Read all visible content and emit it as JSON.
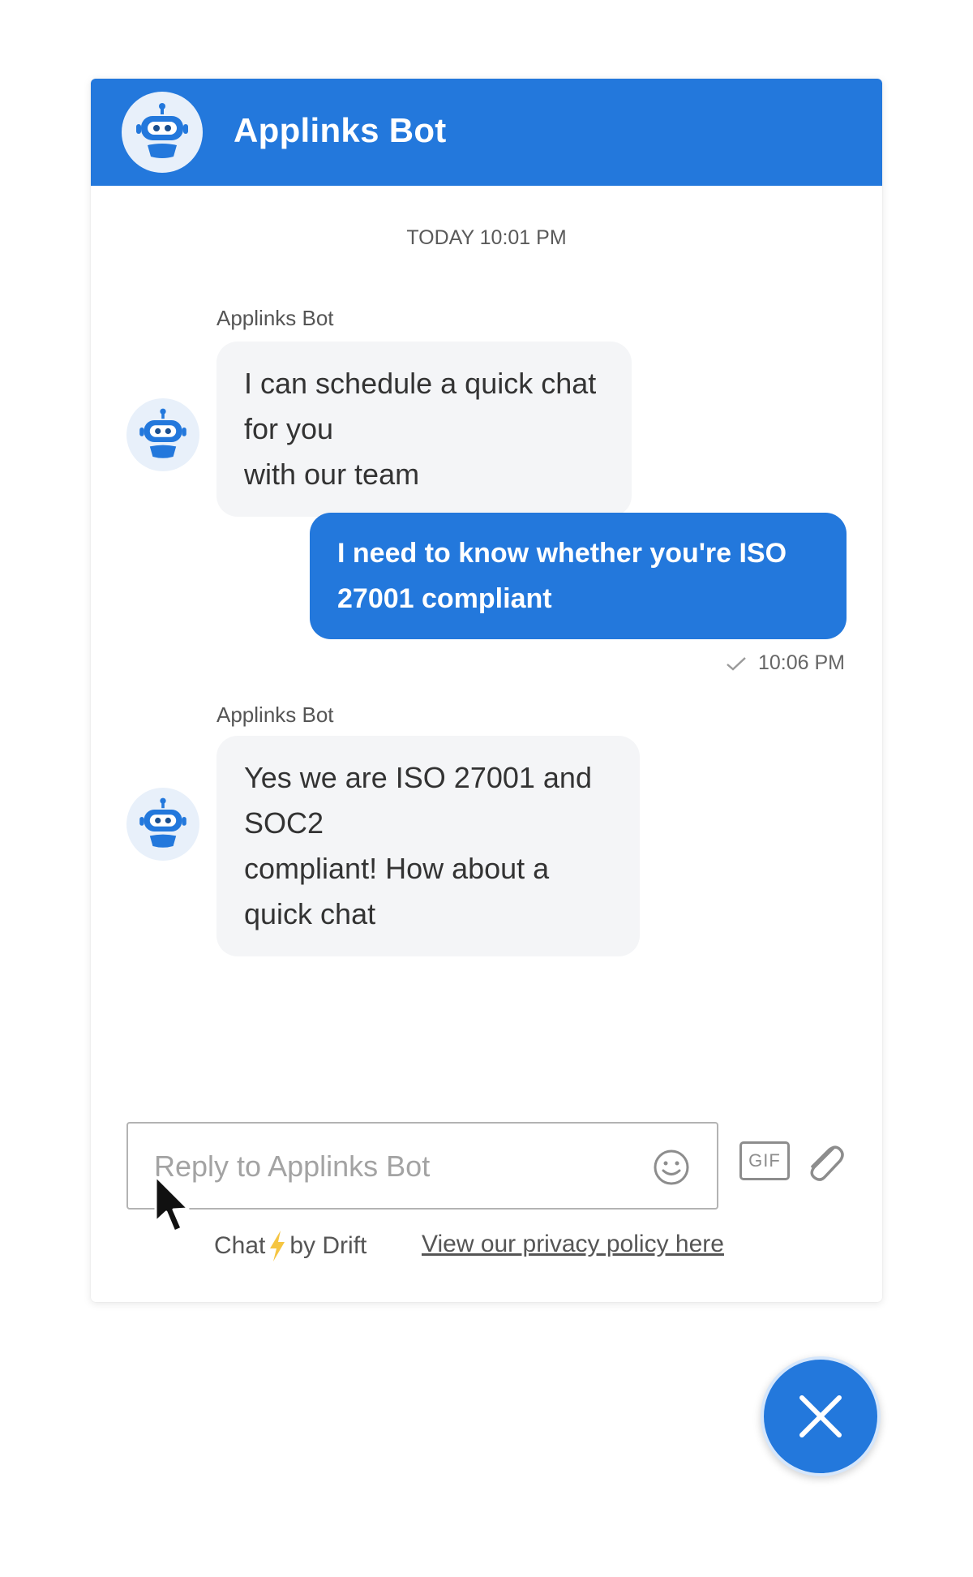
{
  "header": {
    "title": "Applinks Bot",
    "avatar_icon": "robot-icon"
  },
  "conversation": {
    "timestamp": "TODAY 10:01 PM",
    "messages": [
      {
        "from": "bot",
        "sender": "Applinks Bot",
        "text_line1": "I can schedule a quick chat for you",
        "text_line2": "with our team"
      },
      {
        "from": "user",
        "text_line1": "I need to know whether you're ISO",
        "text_line2": "27001 compliant",
        "time": "10:06 PM",
        "status_icon": "check-icon"
      },
      {
        "from": "bot",
        "sender": "Applinks Bot",
        "text_line1": "Yes we are ISO 27001 and SOC2",
        "text_line2": "compliant! How about a quick chat"
      }
    ]
  },
  "composer": {
    "placeholder": "Reply to Applinks Bot",
    "value": "",
    "emoji_icon": "smiley-icon",
    "gif_label": "GIF",
    "attach_icon": "paperclip-icon"
  },
  "footer": {
    "chat_label": "Chat",
    "by_label": "by Drift",
    "bolt_icon": "lightning-icon",
    "privacy_link": "View our privacy policy here"
  },
  "close_button": {
    "icon": "close-icon"
  },
  "colors": {
    "brand_blue": "#2378dc",
    "bot_bubble": "#f4f5f7",
    "bolt_yellow": "#f5c542"
  }
}
